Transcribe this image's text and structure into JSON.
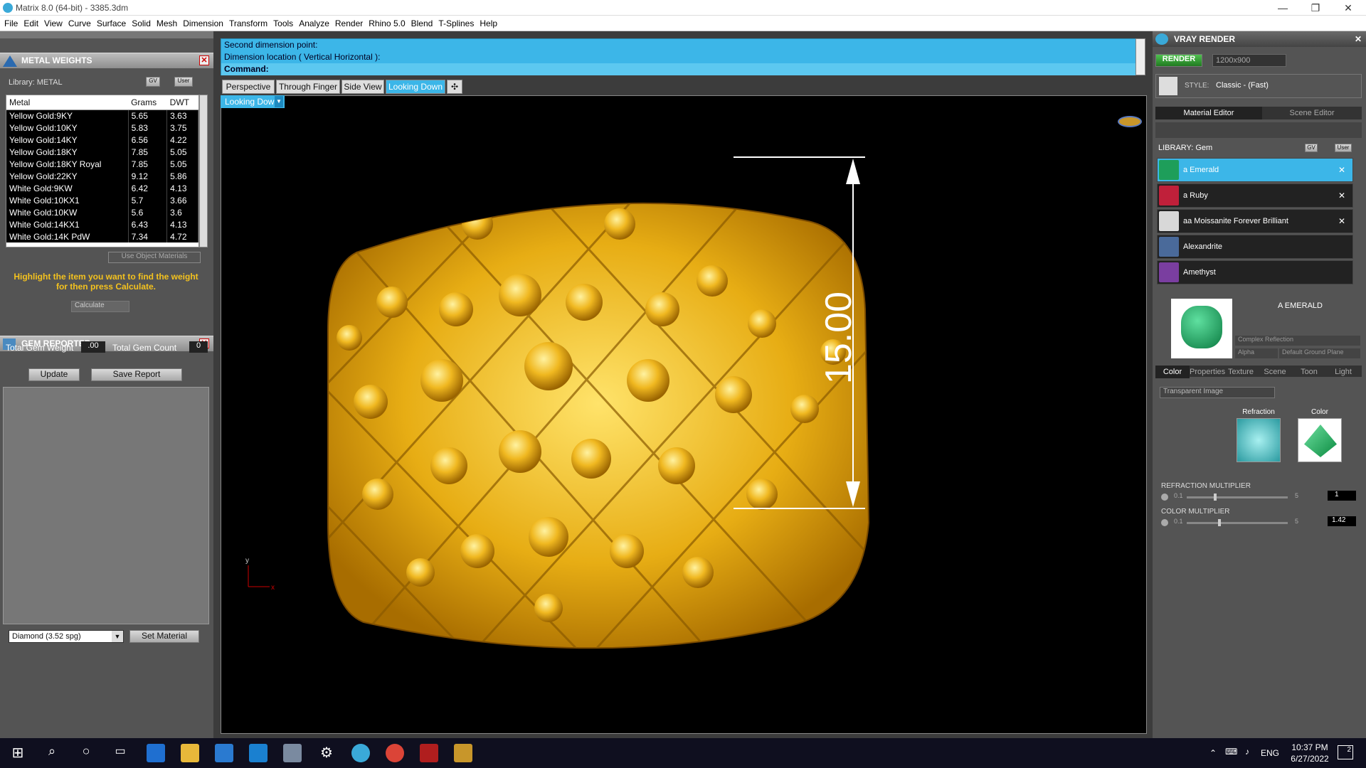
{
  "window": {
    "title": "Matrix 8.0 (64-bit) - 3385.3dm",
    "minimize": "—",
    "maximize": "❐",
    "close": "✕"
  },
  "menu": [
    "File",
    "Edit",
    "View",
    "Curve",
    "Surface",
    "Solid",
    "Mesh",
    "Dimension",
    "Transform",
    "Tools",
    "Analyze",
    "Render",
    "Rhino 5.0",
    "Blend",
    "T-Splines",
    "Help"
  ],
  "metal_weights": {
    "title": "METAL WEIGHTS",
    "library": "Library: METAL",
    "gv": "GV",
    "user": "User",
    "columns": [
      "Metal",
      "Grams",
      "DWT"
    ],
    "rows": [
      [
        "Yellow Gold:9KY",
        "5.65",
        "3.63"
      ],
      [
        "Yellow Gold:10KY",
        "5.83",
        "3.75"
      ],
      [
        "Yellow Gold:14KY",
        "6.56",
        "4.22"
      ],
      [
        "Yellow Gold:18KY",
        "7.85",
        "5.05"
      ],
      [
        "Yellow Gold:18KY Royal",
        "7.85",
        "5.05"
      ],
      [
        "Yellow Gold:22KY",
        "9.12",
        "5.86"
      ],
      [
        "White Gold:9KW",
        "6.42",
        "4.13"
      ],
      [
        "White Gold:10KX1",
        "5.7",
        "3.66"
      ],
      [
        "White Gold:10KW",
        "5.6",
        "3.6"
      ],
      [
        "White Gold:14KX1",
        "6.43",
        "4.13"
      ],
      [
        "White Gold:14K PdW",
        "7.34",
        "4.72"
      ]
    ],
    "use_object_materials": "Use Object Materials",
    "hint": "Highlight the item you want to find the weight for then press Calculate.",
    "calculate": "Calculate"
  },
  "gem_reporter": {
    "title": "GEM REPORTER",
    "total_weight_label": "Total Gem Weight",
    "total_weight": ".00",
    "total_count_label": "Total Gem Count",
    "total_count": "0",
    "update": "Update",
    "save_report": "Save Report",
    "gem_select": "Diamond     (3.52 spg)",
    "set_material": "Set Material"
  },
  "command": {
    "line1": "Second dimension point:",
    "line2": "Dimension location ( Vertical  Horizontal ):",
    "prompt": "Command:"
  },
  "view_tabs": [
    "Perspective",
    "Through Finger",
    "Side View",
    "Looking Down"
  ],
  "active_view": "Looking Down",
  "add_tab": "✣",
  "viewport": {
    "dimension_value": "15.00",
    "axis_y": "y",
    "axis_x": "x"
  },
  "vray": {
    "title": "VRAY RENDER",
    "render_btn": "RENDER",
    "resolution": "1200x900",
    "style_label": "STYLE:",
    "style_value": "Classic - (Fast)",
    "tab_material_editor": "Material Editor",
    "tab_scene_editor": "Scene Editor",
    "library": "LIBRARY: Gem",
    "gv": "GV",
    "user": "User",
    "materials": [
      {
        "name": "a Emerald",
        "color": "#1e9e5a",
        "closable": true,
        "selected": true
      },
      {
        "name": "a Ruby",
        "color": "#c0203a",
        "closable": true,
        "selected": false
      },
      {
        "name": "aa Moissanite Forever Brilliant",
        "color": "#d8d8d8",
        "closable": true,
        "selected": false
      },
      {
        "name": "Alexandrite",
        "color": "#4a6a9a",
        "closable": false,
        "selected": false
      },
      {
        "name": "Amethyst",
        "color": "#7a3ea0",
        "closable": false,
        "selected": false
      }
    ],
    "selected_name": "A EMERALD",
    "reflection": "Complex Reflection",
    "alpha": "Alpha",
    "ground": "Default Ground Plane",
    "subtabs": [
      "Color",
      "Properties",
      "Texture",
      "Scene",
      "Toon",
      "Light"
    ],
    "transparent": "Transparent Image",
    "refraction_label": "Refraction",
    "color_label": "Color",
    "refraction_multiplier_label": "REFRACTION MULTIPLIER",
    "refraction_min": "0.1",
    "refraction_max": "5",
    "refraction_value": "1",
    "color_multiplier_label": "COLOR MULTIPLIER",
    "color_min": "0.1",
    "color_max": "5",
    "color_value": "1.42"
  },
  "taskbar": {
    "lang": "ENG",
    "time": "10:37 PM",
    "date": "6/27/2022",
    "notif_count": "2"
  }
}
